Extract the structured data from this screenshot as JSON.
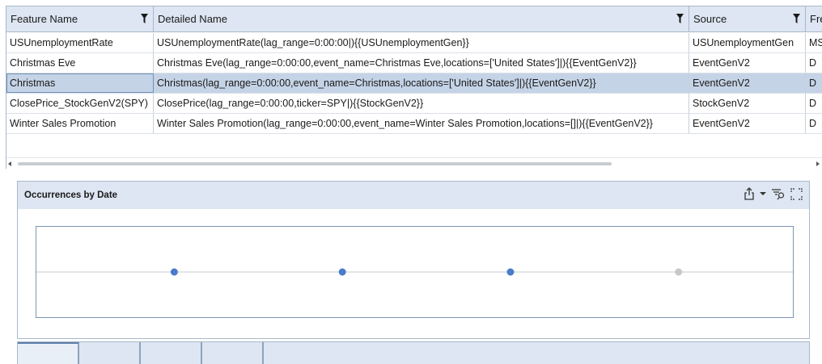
{
  "grid": {
    "columns": [
      "Feature Name",
      "Detailed Name",
      "Source",
      "Fre"
    ],
    "rows": [
      {
        "feature": "USUnemploymentRate",
        "detail": "USUnemploymentRate(lag_range=0:00:00|){{USUnemploymentGen}}",
        "source": "USUnemploymentGen",
        "freq": "MS"
      },
      {
        "feature": "Christmas Eve",
        "detail": "Christmas Eve(lag_range=0:00:00,event_name=Christmas Eve,locations=['United States']|){{EventGenV2}}",
        "source": "EventGenV2",
        "freq": "D"
      },
      {
        "feature": "Christmas",
        "detail": "Christmas(lag_range=0:00:00,event_name=Christmas,locations=['United States']|){{EventGenV2}}",
        "source": "EventGenV2",
        "freq": "D"
      },
      {
        "feature": "ClosePrice_StockGenV2(SPY)",
        "detail": "ClosePrice(lag_range=0:00:00,ticker=SPY|){{StockGenV2}}",
        "source": "StockGenV2",
        "freq": "D"
      },
      {
        "feature": "Winter Sales Promotion",
        "detail": "Winter Sales Promotion(lag_range=0:00:00,event_name=Winter Sales Promotion,locations=[]|){{EventGenV2}}",
        "source": "EventGenV2",
        "freq": "D"
      }
    ],
    "selected_row": 2
  },
  "chart_panel": {
    "title": "Occurrences by Date",
    "icons": [
      "share-icon",
      "dropdown-caret-icon",
      "filter-search-icon",
      "expand-icon"
    ]
  },
  "chart_data": {
    "type": "scatter",
    "title": "Occurrences by Date",
    "xlabel": "",
    "ylabel": "",
    "points": [
      {
        "x": 1,
        "y": 0,
        "color": "#4a7cc9"
      },
      {
        "x": 2,
        "y": 0,
        "color": "#4a7cc9"
      },
      {
        "x": 3,
        "y": 0,
        "color": "#4a7cc9"
      },
      {
        "x": 4,
        "y": 0,
        "color": "#c8c8c8"
      }
    ],
    "xlim": [
      0,
      4.5
    ],
    "grid": false
  },
  "colors": {
    "header_bg": "#dde6f2",
    "selected_row": "#c5d3e6",
    "point": "#4a7cc9",
    "point_inactive": "#c8c8c8"
  },
  "tabs": [
    "",
    "",
    "",
    ""
  ]
}
